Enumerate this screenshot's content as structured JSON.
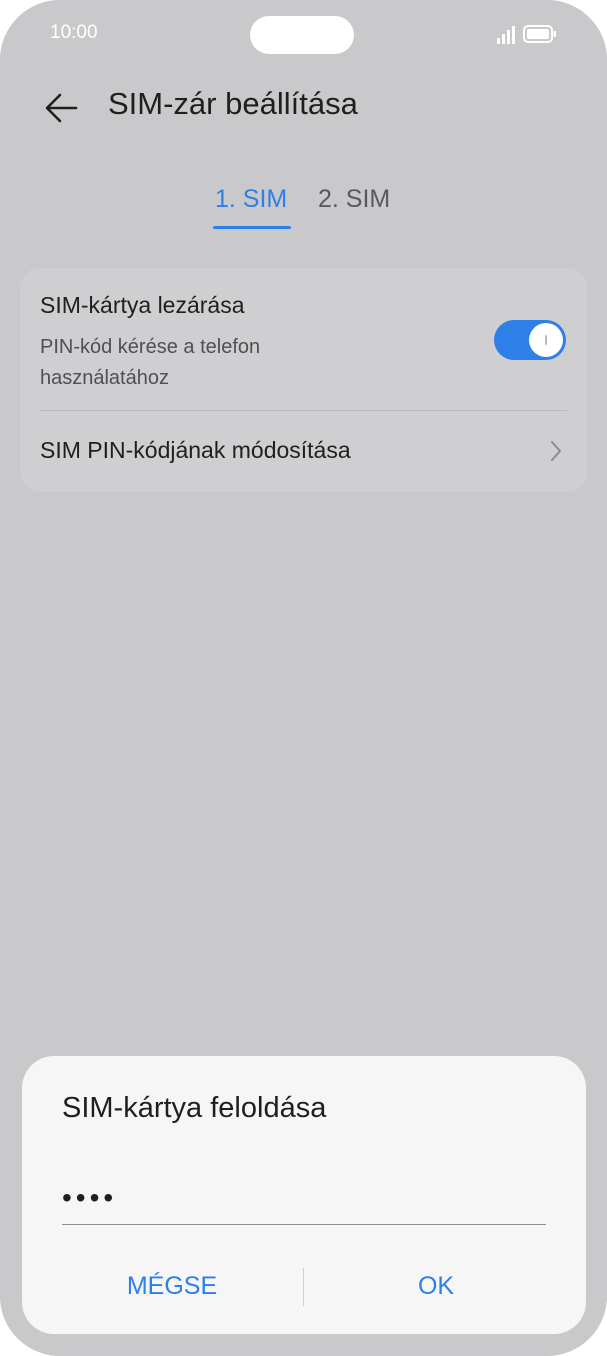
{
  "status_bar": {
    "time": "10:00",
    "icons": [
      "signal-icon",
      "battery-icon"
    ]
  },
  "header": {
    "back_icon": "arrow-left-icon",
    "title": "SIM-zár beállítása"
  },
  "tabs": [
    {
      "label": "1. SIM",
      "active": true
    },
    {
      "label": "2. SIM",
      "active": false
    }
  ],
  "settings": {
    "lock": {
      "title": "SIM-kártya lezárása",
      "subtitle": "PIN-kód kérése a telefon használatához",
      "enabled": true
    },
    "change_pin": {
      "label": "SIM PIN-kódjának módosítása",
      "icon": "chevron-right-icon"
    }
  },
  "dialog": {
    "title": "SIM-kártya feloldása",
    "pin_value": "••••",
    "cancel_label": "MÉGSE",
    "ok_label": "OK"
  },
  "colors": {
    "accent": "#2f7fe8",
    "background": "#c9c9cb",
    "card": "#cfcfd1",
    "dialog": "#f6f6f6"
  }
}
